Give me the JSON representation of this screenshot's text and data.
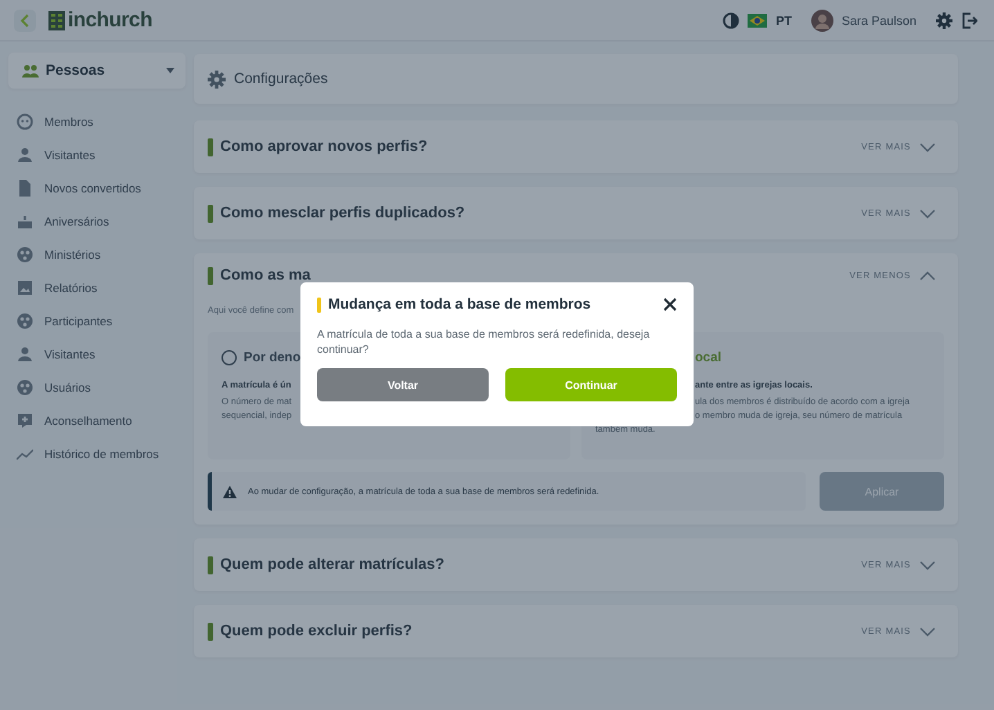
{
  "topbar": {
    "logo": "inchurch",
    "language": "PT",
    "user": "Sara Paulson"
  },
  "sidebar": {
    "header": "Pessoas",
    "items": [
      {
        "label": "Membros"
      },
      {
        "label": "Visitantes"
      },
      {
        "label": "Novos convertidos"
      },
      {
        "label": "Aniversários"
      },
      {
        "label": "Ministérios"
      },
      {
        "label": "Relatórios"
      },
      {
        "label": "Participantes"
      },
      {
        "label": "Visitantes"
      },
      {
        "label": "Usuários"
      },
      {
        "label": "Aconselhamento"
      },
      {
        "label": "Histórico de membros"
      }
    ]
  },
  "page_title": "Configurações",
  "sections": [
    {
      "title": "Como aprovar novos perfis?",
      "toggle": "VER MAIS",
      "expanded": false
    },
    {
      "title": "Como mesclar perfis duplicados?",
      "toggle": "VER MAIS",
      "expanded": false
    },
    {
      "title": "Como as ma",
      "toggle": "VER MENOS",
      "expanded": true,
      "description": "Aqui você define com",
      "options": [
        {
          "title": "Por deno",
          "selected": false,
          "lines": [
            {
              "text": "A matrícula é ún",
              "bold": true
            },
            {
              "text": "O número de mat",
              "bold": false
            },
            {
              "text": "sequencial, indep",
              "bold": false
            }
          ]
        },
        {
          "title": "ocal",
          "selected": true,
          "lines": [
            {
              "text": "ante entre as igrejas locais.",
              "bold": true
            },
            {
              "text": "ula dos membros é distribuído de acordo com a igreja",
              "bold": false
            },
            {
              "text": "o membro muda de igreja, seu número de matrícula",
              "bold": false
            },
            {
              "text": "também muda.",
              "bold": false
            }
          ]
        }
      ],
      "notice": "Ao mudar de configuração, a matrícula de toda a sua base de membros será redefinida.",
      "apply": {
        "label": "Aplicar",
        "disabled": true
      }
    },
    {
      "title": "Quem pode alterar matrículas?",
      "toggle": "VER MAIS",
      "expanded": false
    },
    {
      "title": "Quem pode excluir perfis?",
      "toggle": "VER MAIS",
      "expanded": false
    }
  ],
  "modal": {
    "title": "Mudança em toda a base de membros",
    "message": "A matrícula de toda a sua base de membros será redefinida, deseja continuar?",
    "buttons": [
      {
        "label": "Voltar",
        "kind": "secondary"
      },
      {
        "label": "Continuar",
        "kind": "primary"
      }
    ]
  }
}
